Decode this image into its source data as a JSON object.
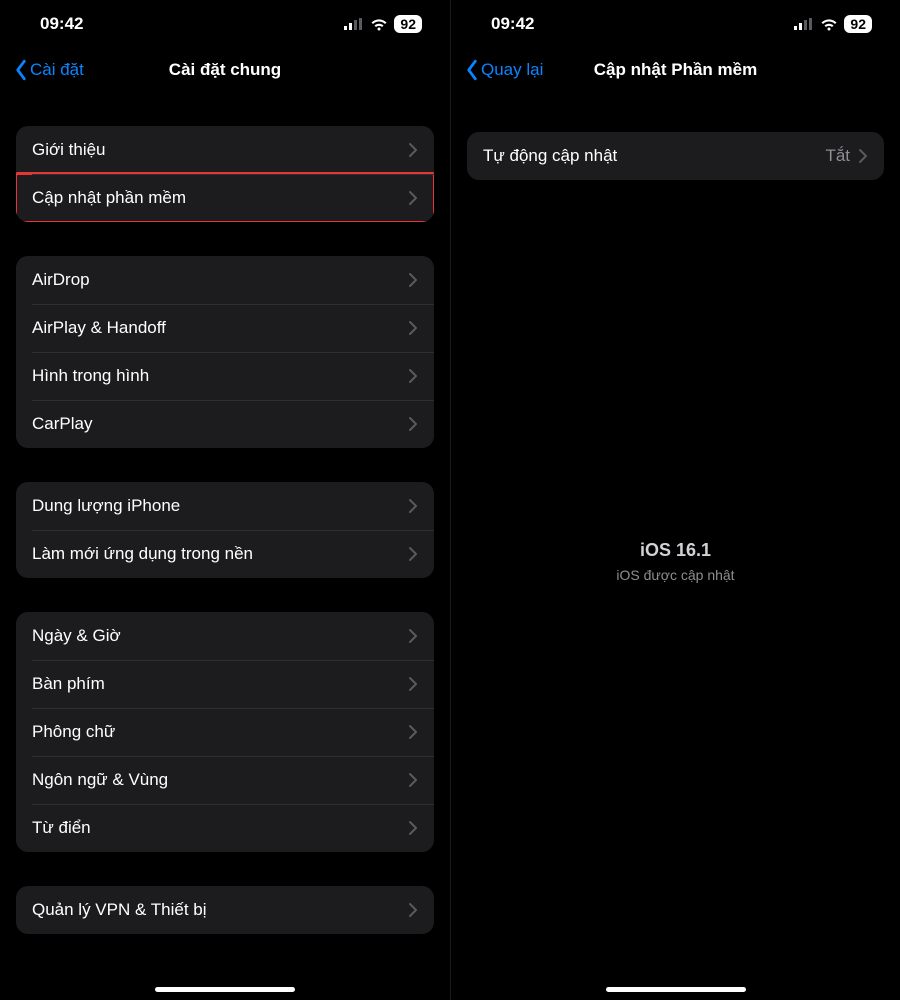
{
  "status": {
    "time": "09:42",
    "battery": "92"
  },
  "left": {
    "back": "Cài đặt",
    "title": "Cài đặt chung",
    "group1": [
      {
        "label": "Giới thiệu"
      },
      {
        "label": "Cập nhật phần mềm"
      }
    ],
    "group2": [
      {
        "label": "AirDrop"
      },
      {
        "label": "AirPlay & Handoff"
      },
      {
        "label": "Hình trong hình"
      },
      {
        "label": "CarPlay"
      }
    ],
    "group3": [
      {
        "label": "Dung lượng iPhone"
      },
      {
        "label": "Làm mới ứng dụng trong nền"
      }
    ],
    "group4": [
      {
        "label": "Ngày & Giờ"
      },
      {
        "label": "Bàn phím"
      },
      {
        "label": "Phông chữ"
      },
      {
        "label": "Ngôn ngữ & Vùng"
      },
      {
        "label": "Từ điển"
      }
    ],
    "group5": [
      {
        "label": "Quản lý VPN & Thiết bị"
      }
    ]
  },
  "right": {
    "back": "Quay lại",
    "title": "Cập nhật Phần mềm",
    "auto": {
      "label": "Tự động cập nhật",
      "value": "Tắt"
    },
    "version": "iOS 16.1",
    "status": "iOS được cập nhật"
  }
}
